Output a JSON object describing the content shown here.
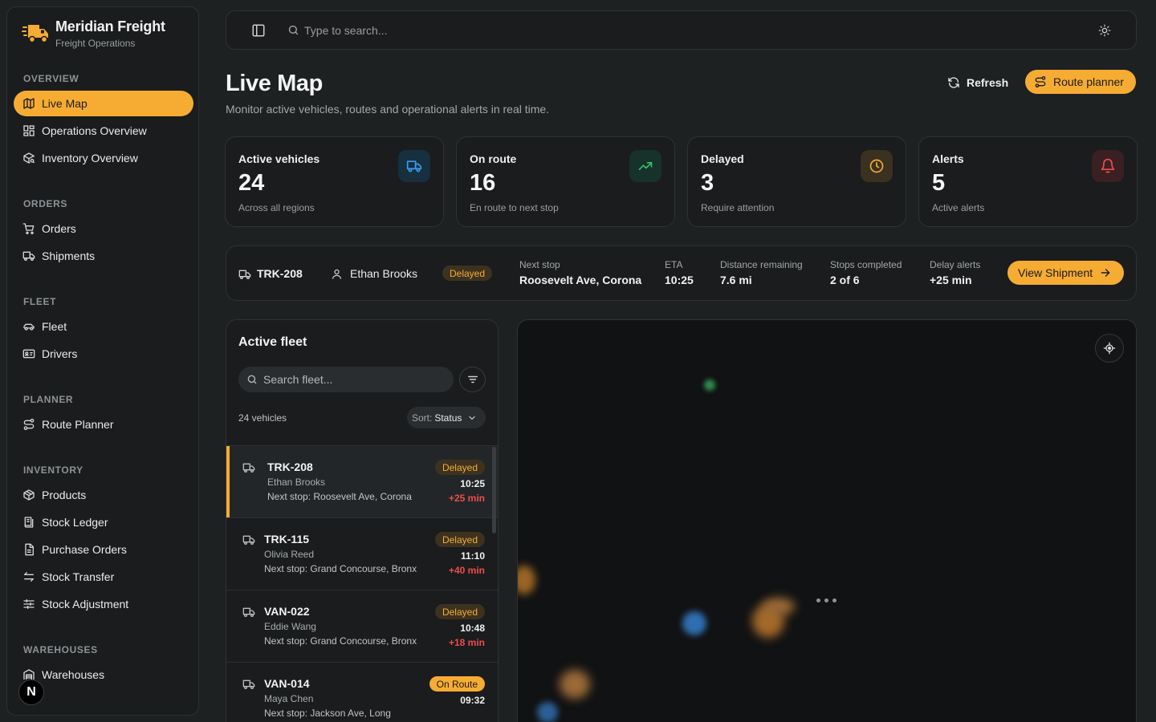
{
  "brand": {
    "name": "Meridian Freight",
    "subtitle": "Freight Operations"
  },
  "sidebar": {
    "sections": [
      {
        "title": "OVERVIEW",
        "items": [
          {
            "label": "Live Map",
            "icon": "map-icon",
            "active": true
          },
          {
            "label": "Operations Overview",
            "icon": "dashboard-icon"
          },
          {
            "label": "Inventory Overview",
            "icon": "package-search-icon"
          }
        ]
      },
      {
        "title": "ORDERS",
        "items": [
          {
            "label": "Orders",
            "icon": "cart-icon"
          },
          {
            "label": "Shipments",
            "icon": "truck-icon"
          }
        ]
      },
      {
        "title": "FLEET",
        "items": [
          {
            "label": "Fleet",
            "icon": "car-icon"
          },
          {
            "label": "Drivers",
            "icon": "id-card-icon"
          }
        ]
      },
      {
        "title": "PLANNER",
        "items": [
          {
            "label": "Route Planner",
            "icon": "route-icon"
          }
        ]
      },
      {
        "title": "INVENTORY",
        "items": [
          {
            "label": "Products",
            "icon": "box-icon"
          },
          {
            "label": "Stock Ledger",
            "icon": "ledger-icon"
          },
          {
            "label": "Purchase Orders",
            "icon": "document-icon"
          },
          {
            "label": "Stock Transfer",
            "icon": "transfer-icon"
          },
          {
            "label": "Stock Adjustment",
            "icon": "sliders-icon"
          }
        ]
      },
      {
        "title": "WAREHOUSES",
        "items": [
          {
            "label": "Warehouses",
            "icon": "warehouse-icon"
          }
        ]
      }
    ],
    "badge_letter": "N"
  },
  "topbar": {
    "search_placeholder": "Type to search..."
  },
  "header": {
    "title": "Live Map",
    "subtitle": "Monitor active vehicles, routes and operational alerts in real time.",
    "refresh_label": "Refresh",
    "route_planner_label": "Route planner"
  },
  "stats": [
    {
      "label": "Active vehicles",
      "value": "24",
      "sub": "Across all regions",
      "icon": "truck-icon",
      "color": "#3b9cf5",
      "bg": "#16303f"
    },
    {
      "label": "On route",
      "value": "16",
      "sub": "En route to next stop",
      "icon": "trending-up-icon",
      "color": "#32c36c",
      "bg": "#16322a"
    },
    {
      "label": "Delayed",
      "value": "3",
      "sub": "Require attention",
      "icon": "clock-icon",
      "color": "#f6ac33",
      "bg": "#3a3120"
    },
    {
      "label": "Alerts",
      "value": "5",
      "sub": "Active alerts",
      "icon": "bell-icon",
      "color": "#ef4d4d",
      "bg": "#3a2022"
    }
  ],
  "selected_shipment": {
    "truck_id": "TRK-208",
    "driver": "Ethan Brooks",
    "status": "Delayed",
    "next_stop_label": "Next stop",
    "next_stop": "Roosevelt Ave, Corona",
    "eta_label": "ETA",
    "eta": "10:25",
    "distance_label": "Distance remaining",
    "distance": "7.6 mi",
    "stops_label": "Stops completed",
    "stops": "2 of 6",
    "delay_label": "Delay alerts",
    "delay": "+25 min",
    "view_label": "View Shipment"
  },
  "fleet": {
    "title": "Active fleet",
    "search_placeholder": "Search fleet...",
    "count": "24 vehicles",
    "sort_label": "Sort:",
    "sort_value": "Status",
    "rows": [
      {
        "id": "TRK-208",
        "driver": "Ethan Brooks",
        "next": "Next stop: Roosevelt Ave, Corona",
        "status": "Delayed",
        "eta": "10:25",
        "delay": "+25 min"
      },
      {
        "id": "TRK-115",
        "driver": "Olivia Reed",
        "next": "Next stop: Grand Concourse, Bronx",
        "status": "Delayed",
        "eta": "11:10",
        "delay": "+40 min"
      },
      {
        "id": "VAN-022",
        "driver": "Eddie Wang",
        "next": "Next stop: Grand Concourse, Bronx",
        "status": "Delayed",
        "eta": "10:48",
        "delay": "+18 min"
      },
      {
        "id": "VAN-014",
        "driver": "Maya Chen",
        "next": "Next stop: Jackson Ave, Long",
        "status": "On Route",
        "eta": "09:32",
        "delay": ""
      }
    ]
  },
  "colors": {
    "accent": "#f6ac33",
    "danger": "#ef4d4d",
    "success": "#32c36c",
    "info": "#3b9cf5"
  }
}
